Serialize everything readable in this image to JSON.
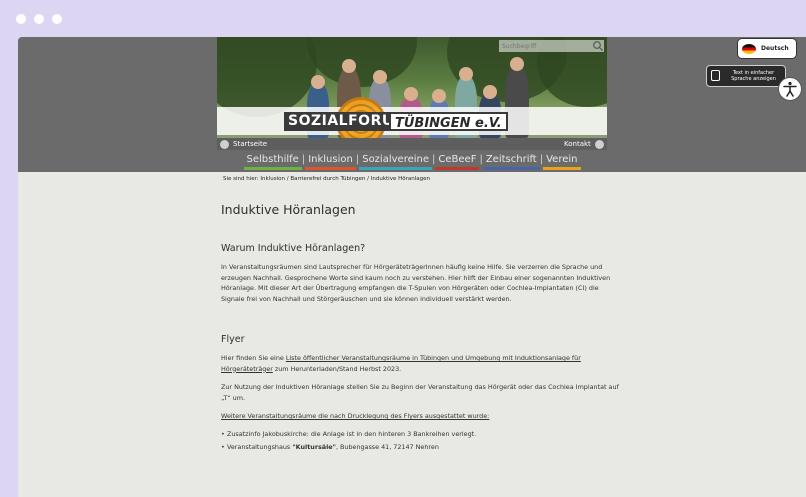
{
  "header": {
    "search_placeholder": "Suchbegriff",
    "logo_main": "SOZIALFORUM",
    "logo_accent": "TÜBINGEN e.V.",
    "home_link": "Startseite",
    "contact_link": "Kontakt"
  },
  "nav": {
    "items": [
      {
        "label": "Selbsthilfe",
        "color": "#6cb33f"
      },
      {
        "label": "Inklusion",
        "color": "#e0532c"
      },
      {
        "label": "Sozialvereine",
        "color": "#3aa6b9"
      },
      {
        "label": "CeBeeF",
        "color": "#c0392b"
      },
      {
        "label": "Zeitschrift",
        "color": "#4a64a8"
      },
      {
        "label": "Verein",
        "color": "#e8a317"
      }
    ]
  },
  "breadcrumb": "Sie sind hier:  Inklusion / Barrierefrei durch Tübingen / Induktive Höranlagen",
  "language": {
    "label": "Deutsch"
  },
  "simple_language": {
    "line1": "Text in einfacher",
    "line2": "Sprache anzeigen"
  },
  "content": {
    "title": "Induktive Höranlagen",
    "section1_heading": "Warum Induktive Höranlagen?",
    "section1_text": "In Veranstaltungsräumen sind Lautsprecher für HörgeräteträgerInnen häufig keine Hilfe. Sie verzerren die Sprache  und erzeugen Nachhall. Gesprochene Worte sind kaum noch zu verstehen. Hier hilft der Einbau einer sogenannten  Induktiven Höranlage. Mit dieser Art der Übertragung empfangen die T-Spulen von Hörgeräten oder Cochlea-Implantaten (CI) die Signale frei von Nachhall und Störgeräuschen und sie können individuell verstärkt werden.",
    "section2_heading": "Flyer",
    "flyer_pre": "Hier finden Sie eine ",
    "flyer_link": "Liste öffentlicher Veranstaltungsräume in Tübingen und Umgebung mit Induktionsanlage für Hörgeräteträger",
    "flyer_post": " zum Herunterladen/Stand Herbst 2023.",
    "usage_text": "Zur Nutzung der Induktiven Höranlage stellen Sie zu Beginn der Veranstaltung das Hörgerät oder das Cochlea Implantat auf „T“ um.",
    "more_rooms": "Weitere Veranstaltungsräume die nach Drucklegung des Flyers ausgestattet wurde:",
    "bullets": [
      {
        "pre": "Zusatzinfo Jakobuskirche: die Anlage ist in den hinteren 3 Bankreihen verlegt.",
        "bold": "",
        "post": ""
      },
      {
        "pre": "Veranstaltungshaus ",
        "bold": "\"Kultursäle\"",
        "post": ", Bubengasse 41, 72147 Nehren"
      }
    ]
  }
}
